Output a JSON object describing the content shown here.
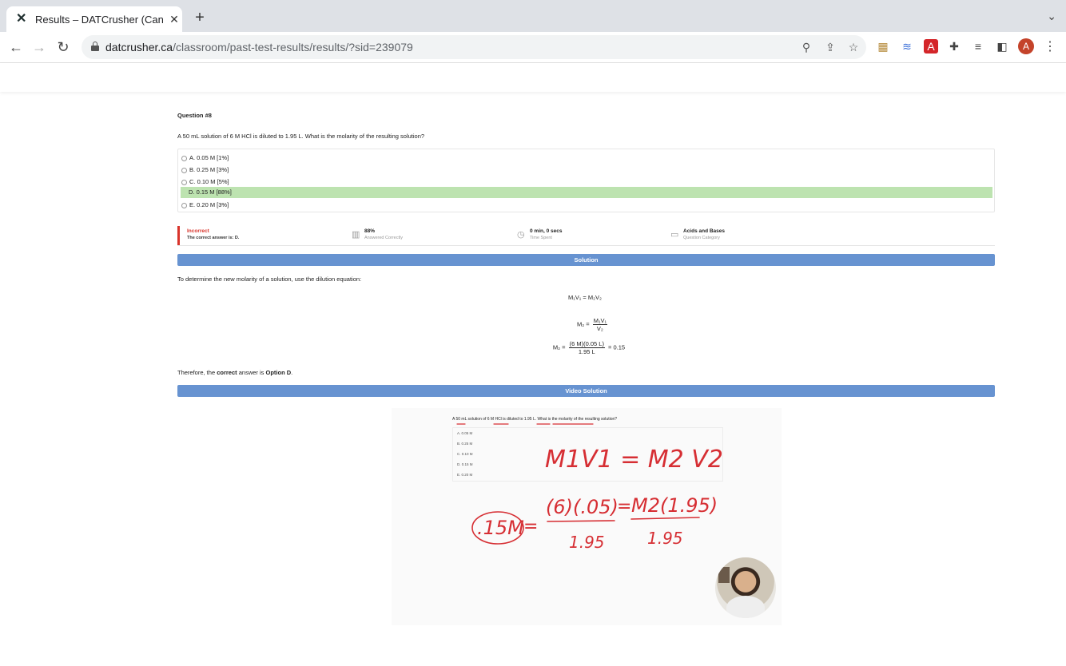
{
  "browser": {
    "tab_title": "Results – DATCrusher (Canadia",
    "url_domain": "datcrusher.ca",
    "url_path": "/classroom/past-test-results/results/?sid=239079",
    "profile_initial": "A"
  },
  "question": {
    "number": "Question #8",
    "text": "A 50 mL solution of 6 M HCl is diluted to 1.95 L. What is the molarity of the resulting solution?",
    "options": [
      {
        "label": "A. 0.05 M [1%]"
      },
      {
        "label": "B. 0.25 M [3%]"
      },
      {
        "label": "C. 0.10 M [5%]"
      },
      {
        "label": "D. 0.15 M [88%]",
        "correct": true
      },
      {
        "label": "E. 0.20 M [3%]"
      }
    ]
  },
  "stats": {
    "result": "Incorrect",
    "correct_answer": "The correct answer is: D.",
    "percent": "88%",
    "percent_label": "Answered Correctly",
    "time": "0 min, 0 secs",
    "time_label": "Time Spent",
    "category": "Acids and Bases",
    "category_label": "Question Category"
  },
  "solution": {
    "header": "Solution",
    "intro": "To determine the new molarity of a solution, use the dilution equation:",
    "eq1": "M₁V₁ = M₂V₂",
    "eq2_lhs": "M₂ =",
    "eq2_num": "M₁V₁",
    "eq2_den": "V₂",
    "eq3_lhs": "M₂ =",
    "eq3_num": "(6 M)(0.05 L)",
    "eq3_den": "1.95 L",
    "eq3_rhs": "= 0.15",
    "conclusion_pre": "Therefore, the ",
    "conclusion_bold": "correct",
    "conclusion_mid": " answer is ",
    "conclusion_option": "Option D",
    "conclusion_end": "."
  },
  "video": {
    "header": "Video Solution",
    "question": "A 50 mL solution of 6 M HCl is diluted to 1.95 L. What is the molarity of the resulting solution?",
    "options": [
      "A. 0.05 M",
      "B. 0.25 M",
      "C. 0.10 M",
      "D. 0.15 M",
      "E. 0.20 M"
    ],
    "handwriting_eq": "M1V1 = M2 V2",
    "handwriting_answer": ".15M",
    "handwriting_num": "(6)(.05)",
    "handwriting_rhs": "M2(1.95)",
    "handwriting_den1": "1.95",
    "handwriting_den2": "1.95"
  },
  "colors": {
    "correct_bg": "#bde3b0",
    "banner": "#6793d1",
    "incorrect": "#d9342b",
    "ink": "#d62e33"
  }
}
